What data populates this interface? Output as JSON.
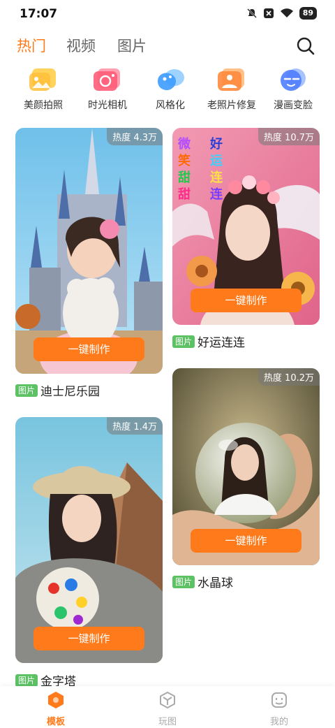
{
  "status_bar": {
    "time": "17:07",
    "battery": "89"
  },
  "tabs": [
    {
      "label": "热门",
      "active": true
    },
    {
      "label": "视频",
      "active": false
    },
    {
      "label": "图片",
      "active": false
    }
  ],
  "shortcuts": [
    {
      "label": "美颜拍照",
      "icon": "beauty-photo-icon",
      "color": "#ffc94a"
    },
    {
      "label": "时光相机",
      "icon": "time-camera-icon",
      "color": "#ff6b7e"
    },
    {
      "label": "风格化",
      "icon": "stylize-icon",
      "color": "#4da3ff"
    },
    {
      "label": "老照片修复",
      "icon": "photo-restore-icon",
      "color": "#ff9147"
    },
    {
      "label": "漫画变脸",
      "icon": "comic-face-icon",
      "color": "#5b8cff"
    }
  ],
  "cards": [
    {
      "heat": "热度 4.3万",
      "button": "一键制作",
      "tag": "图片",
      "title": "迪士尼乐园"
    },
    {
      "heat": "热度 10.7万",
      "button": "一键制作",
      "tag": "图片",
      "title": "好运连连",
      "overlay_text": [
        "微",
        "笑",
        "甜",
        "甜",
        "好",
        "运",
        "连",
        "连"
      ]
    },
    {
      "heat": "热度 1.4万",
      "button": "一键制作",
      "tag": "图片",
      "title": "金字塔"
    },
    {
      "heat": "热度 10.2万",
      "button": "一键制作",
      "tag": "图片",
      "title": "水晶球"
    }
  ],
  "bottom_nav": [
    {
      "label": "模板",
      "active": true
    },
    {
      "label": "玩图",
      "active": false
    },
    {
      "label": "我的",
      "active": false
    }
  ],
  "colors": {
    "accent": "#ff7a1a",
    "tag_green": "#5cc264"
  }
}
